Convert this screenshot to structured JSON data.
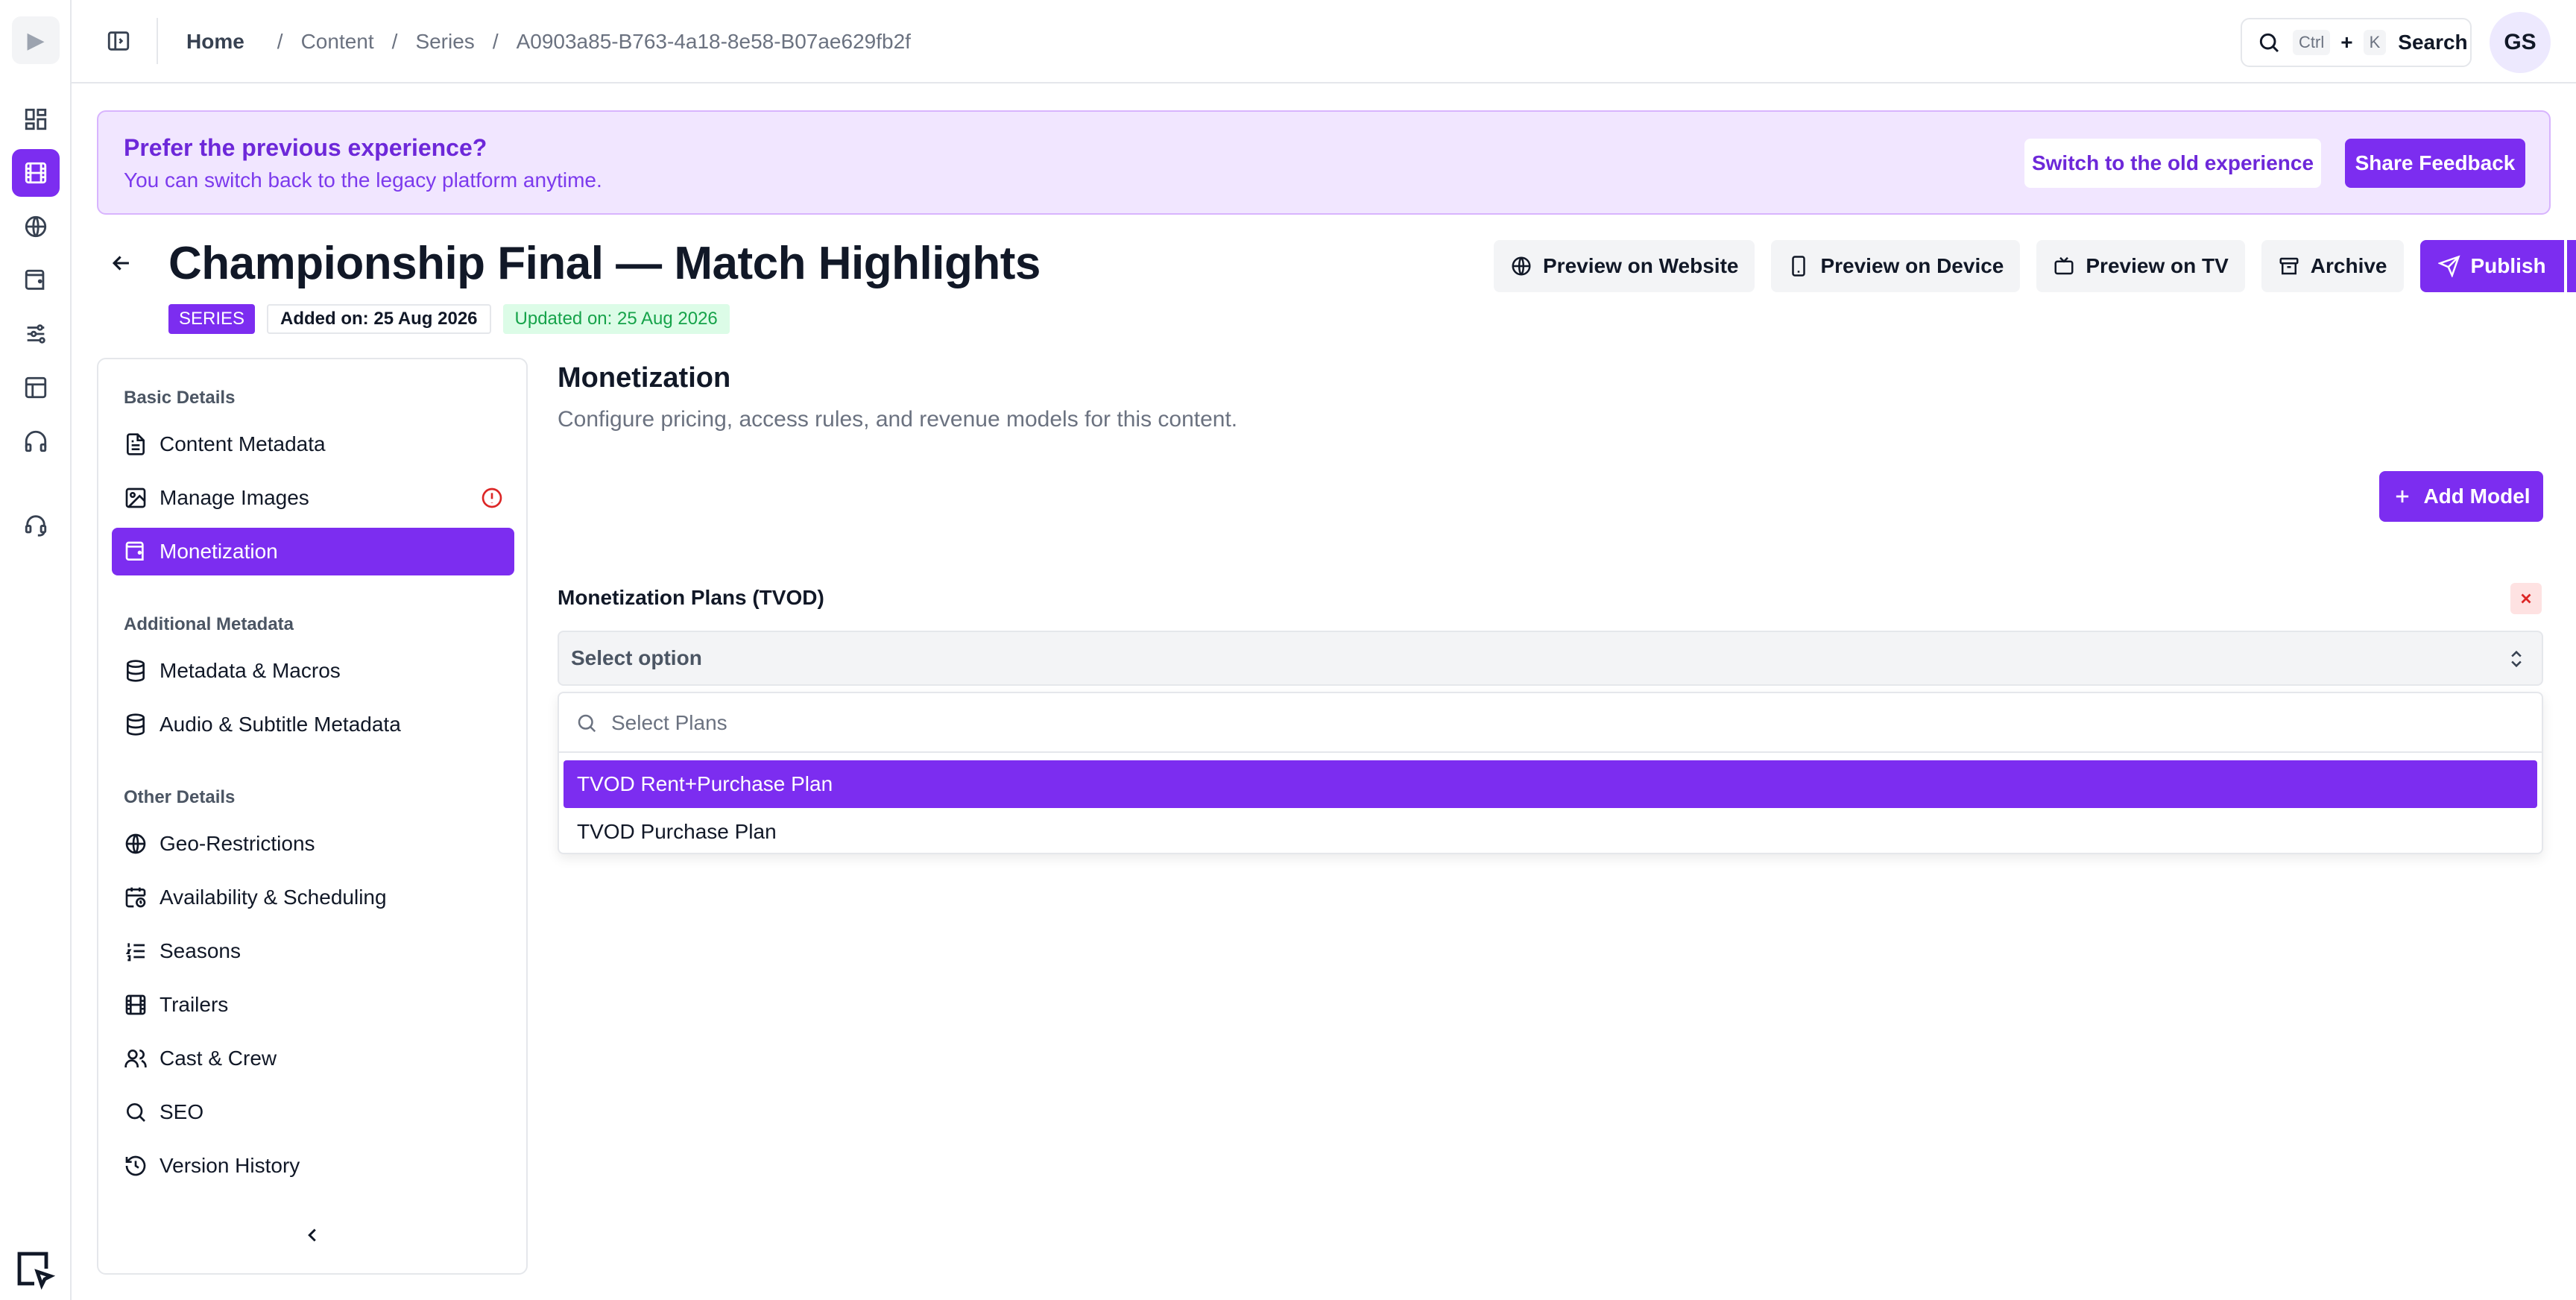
{
  "app": {
    "logo_glyph": "▶"
  },
  "rail": {
    "items": [
      {
        "icon": "dashboard-icon",
        "active": false
      },
      {
        "icon": "film-icon",
        "active": true
      },
      {
        "icon": "globe-icon",
        "active": false
      },
      {
        "icon": "wallet-icon",
        "active": false
      },
      {
        "icon": "sliders-icon",
        "active": false
      },
      {
        "icon": "layout-icon",
        "active": false
      },
      {
        "icon": "headphones-icon",
        "active": false
      },
      {
        "icon": "headset-icon",
        "active": false
      }
    ]
  },
  "breadcrumb": {
    "home": "Home",
    "separator": "/",
    "items": [
      "Content",
      "Series",
      "A0903a85-B763-4a18-8e58-B07ae629fb2f"
    ]
  },
  "search": {
    "key1": "Ctrl",
    "plus": "+",
    "key2": "K",
    "label": "Search"
  },
  "user": {
    "initials": "GS"
  },
  "banner": {
    "title": "Prefer the previous experience?",
    "subtitle": "You can switch back to the legacy platform anytime.",
    "switch_label": "Switch to the old experience",
    "feedback_label": "Share Feedback"
  },
  "page": {
    "title": "Championship Final — Match Highlights",
    "type_badge": "SERIES",
    "added": "Added on: 25 Aug 2026",
    "updated": "Updated on: 25 Aug 2026"
  },
  "actions": {
    "preview_website": "Preview on Website",
    "preview_device": "Preview on Device",
    "preview_tv": "Preview on TV",
    "archive": "Archive",
    "publish": "Publish"
  },
  "nav": {
    "basic_title": "Basic Details",
    "content_metadata": "Content Metadata",
    "manage_images": "Manage Images",
    "monetization": "Monetization",
    "additional_title": "Additional Metadata",
    "metadata_macros": "Metadata & Macros",
    "audio_subtitle": "Audio & Subtitle Metadata",
    "other_title": "Other Details",
    "geo": "Geo-Restrictions",
    "availability": "Availability & Scheduling",
    "seasons": "Seasons",
    "trailers": "Trailers",
    "cast": "Cast & Crew",
    "seo": "SEO",
    "version_history": "Version History"
  },
  "main": {
    "title": "Monetization",
    "subtitle": "Configure pricing, access rules, and revenue models for this content.",
    "add_model": "Add Model",
    "plans_label": "Monetization Plans (TVOD)",
    "select_placeholder": "Select option",
    "dropdown_search_placeholder": "Select Plans",
    "options": [
      {
        "label": "TVOD Rent+Purchase Plan",
        "selected": true
      },
      {
        "label": "TVOD Purchase Plan",
        "selected": false
      }
    ]
  },
  "colors": {
    "accent": "#7c2df0",
    "banner_bg": "#f1e6ff",
    "success": "#16a34a",
    "danger": "#dc2626"
  }
}
